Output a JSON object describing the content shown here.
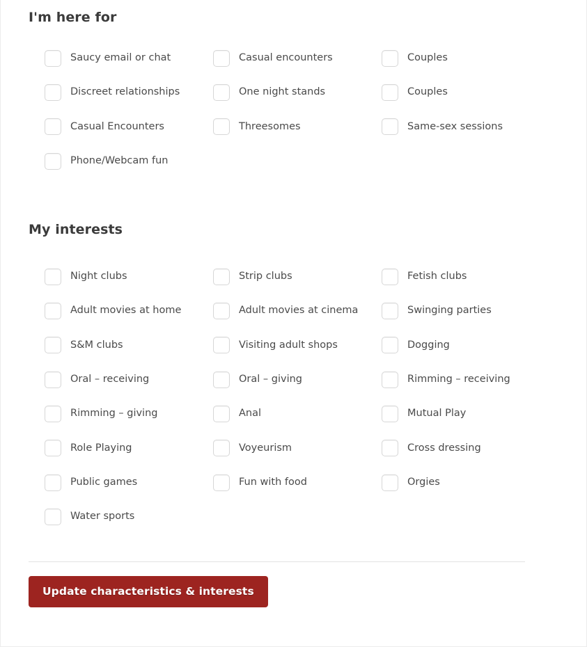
{
  "sections": [
    {
      "id": "here-for",
      "heading": "I'm here for",
      "columns": [
        [
          "Saucy email or chat",
          "Discreet relationships",
          "Casual Encounters",
          "Phone/Webcam fun"
        ],
        [
          "Casual encounters",
          "One night stands",
          "Threesomes"
        ],
        [
          "Couples",
          "Couples",
          "Same-sex sessions"
        ]
      ]
    },
    {
      "id": "my-interests",
      "heading": "My interests",
      "columns": [
        [
          "Night clubs",
          "Adult movies at home",
          "S&M clubs",
          "Oral – receiving",
          "Rimming – giving",
          "Role Playing",
          "Public games",
          "Water sports"
        ],
        [
          "Strip clubs",
          "Adult movies at cinema",
          "Visiting adult shops",
          "Oral – giving",
          "Anal",
          "Voyeurism",
          "Fun with food"
        ],
        [
          "Fetish clubs",
          "Swinging parties",
          "Dogging",
          "Rimming – receiving",
          "Mutual Play",
          "Cross dressing",
          "Orgies"
        ]
      ]
    }
  ],
  "footer": {
    "submit_label": "Update characteristics & interests"
  },
  "colors": {
    "button_background": "#9d2420",
    "button_text": "#ffffff",
    "heading_text": "#3b3b3b",
    "label_text": "#4a4a4a",
    "checkbox_border": "#d7d7d7",
    "divider": "#e2e2e2",
    "page_background": "#ffffff"
  }
}
